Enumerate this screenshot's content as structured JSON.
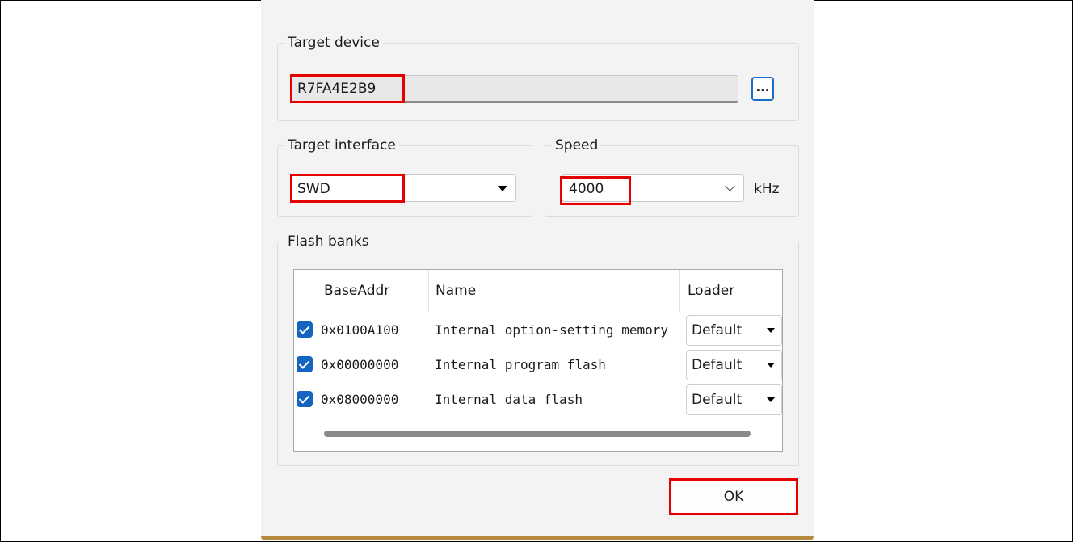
{
  "target_device": {
    "legend": "Target device",
    "value": "R7FA4E2B9",
    "browse_label": "..."
  },
  "target_interface": {
    "legend": "Target interface",
    "selected": "SWD"
  },
  "speed": {
    "legend": "Speed",
    "value": "4000",
    "unit": "kHz"
  },
  "flash_banks": {
    "legend": "Flash banks",
    "columns": [
      "BaseAddr",
      "Name",
      "Loader"
    ],
    "rows": [
      {
        "checked": true,
        "base_addr": "0x0100A100",
        "name": "Internal option-setting memory",
        "loader": "Default"
      },
      {
        "checked": true,
        "base_addr": "0x00000000",
        "name": "Internal program flash",
        "loader": "Default"
      },
      {
        "checked": true,
        "base_addr": "0x08000000",
        "name": "Internal data flash",
        "loader": "Default"
      }
    ]
  },
  "ok_label": "OK",
  "colors": {
    "highlight": "#e60000",
    "checkbox": "#1565c0",
    "accent": "#1c6fc9"
  }
}
